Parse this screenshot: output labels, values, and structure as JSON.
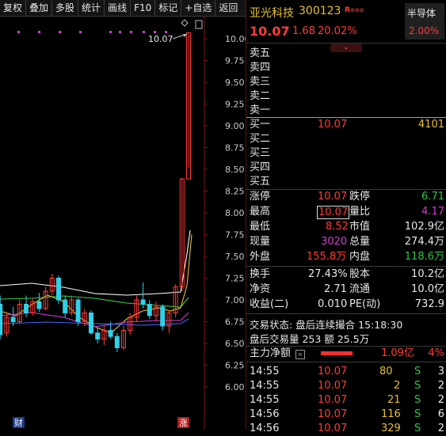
{
  "toolbar": {
    "items": [
      "复权",
      "叠加",
      "多股",
      "统计",
      "画线",
      "F10",
      "标记",
      "+自选",
      "返回"
    ]
  },
  "chart": {
    "price_ticks": [
      "10.00",
      "9.75",
      "9.50",
      "9.25",
      "9.00",
      "8.75",
      "8.50",
      "8.25",
      "8.00",
      "7.75",
      "7.50",
      "7.25",
      "7.00",
      "6.75",
      "6.50",
      "6.25",
      "6.00"
    ],
    "high_label": "10.07",
    "marker_cai": "财",
    "marker_zhang": "涨"
  },
  "chart_data": {
    "type": "candlestick",
    "ylim": [
      5.8,
      10.1
    ],
    "y_ticks": [
      6.0,
      6.25,
      6.5,
      6.75,
      7.0,
      7.25,
      7.5,
      7.75,
      8.0,
      8.25,
      8.5,
      8.75,
      9.0,
      9.25,
      9.5,
      9.75,
      10.0
    ],
    "candles": [
      {
        "o": 6.95,
        "h": 7.05,
        "l": 6.55,
        "c": 6.6
      },
      {
        "o": 6.62,
        "h": 6.85,
        "l": 6.58,
        "c": 6.8
      },
      {
        "o": 6.8,
        "h": 6.92,
        "l": 6.7,
        "c": 6.75
      },
      {
        "o": 6.75,
        "h": 7.0,
        "l": 6.72,
        "c": 6.95
      },
      {
        "o": 6.95,
        "h": 7.05,
        "l": 6.8,
        "c": 6.85
      },
      {
        "o": 6.85,
        "h": 7.02,
        "l": 6.82,
        "c": 6.98
      },
      {
        "o": 6.98,
        "h": 7.08,
        "l": 6.86,
        "c": 6.9
      },
      {
        "o": 6.9,
        "h": 7.15,
        "l": 6.88,
        "c": 7.1
      },
      {
        "o": 7.1,
        "h": 7.3,
        "l": 7.05,
        "c": 7.25
      },
      {
        "o": 7.25,
        "h": 7.28,
        "l": 6.95,
        "c": 7.0
      },
      {
        "o": 7.0,
        "h": 7.05,
        "l": 6.8,
        "c": 6.85
      },
      {
        "o": 6.85,
        "h": 7.05,
        "l": 6.82,
        "c": 7.0
      },
      {
        "o": 7.0,
        "h": 7.02,
        "l": 6.7,
        "c": 6.75
      },
      {
        "o": 6.75,
        "h": 6.9,
        "l": 6.7,
        "c": 6.85
      },
      {
        "o": 6.85,
        "h": 6.88,
        "l": 6.6,
        "c": 6.62
      },
      {
        "o": 6.62,
        "h": 6.68,
        "l": 6.5,
        "c": 6.55
      },
      {
        "o": 6.55,
        "h": 6.7,
        "l": 6.48,
        "c": 6.65
      },
      {
        "o": 6.65,
        "h": 6.75,
        "l": 6.55,
        "c": 6.58
      },
      {
        "o": 6.58,
        "h": 6.62,
        "l": 6.4,
        "c": 6.45
      },
      {
        "o": 6.45,
        "h": 6.7,
        "l": 6.42,
        "c": 6.65
      },
      {
        "o": 6.65,
        "h": 6.85,
        "l": 6.6,
        "c": 6.8
      },
      {
        "o": 6.8,
        "h": 7.05,
        "l": 6.75,
        "c": 7.0
      },
      {
        "o": 7.0,
        "h": 7.2,
        "l": 6.9,
        "c": 6.95
      },
      {
        "o": 6.95,
        "h": 7.0,
        "l": 6.78,
        "c": 6.82
      },
      {
        "o": 6.82,
        "h": 6.98,
        "l": 6.75,
        "c": 6.92
      },
      {
        "o": 6.92,
        "h": 6.95,
        "l": 6.65,
        "c": 6.7
      },
      {
        "o": 6.7,
        "h": 6.88,
        "l": 6.62,
        "c": 6.85
      },
      {
        "o": 6.85,
        "h": 7.18,
        "l": 6.8,
        "c": 7.15
      },
      {
        "o": 7.15,
        "h": 8.4,
        "l": 7.1,
        "c": 8.39
      },
      {
        "o": 8.39,
        "h": 10.07,
        "l": 8.52,
        "c": 10.07
      }
    ]
  },
  "quote": {
    "name": "亚光科技",
    "code": "300123",
    "r_badge": "R",
    "sector": "半导体",
    "price": "10.07",
    "change": "1.68",
    "change_pct": "20.02%",
    "sector_pct": "2.00%"
  },
  "order_book": {
    "sells": [
      "卖五",
      "卖四",
      "卖三",
      "卖二",
      "卖一"
    ],
    "buys": [
      {
        "label": "买一",
        "price": "10.07",
        "vol": "4101"
      },
      {
        "label": "买二",
        "price": "",
        "vol": ""
      },
      {
        "label": "买三",
        "price": "",
        "vol": ""
      },
      {
        "label": "买四",
        "price": "",
        "vol": ""
      },
      {
        "label": "买五",
        "price": "",
        "vol": ""
      }
    ]
  },
  "stats": {
    "limit_up_label": "涨停",
    "limit_up": "10.07",
    "limit_down_label": "跌停",
    "limit_down": "6.71",
    "high_label": "最高",
    "high": "10.07",
    "vol_ratio_label": "量比",
    "vol_ratio": "4.17",
    "low_label": "最低",
    "low": "8.52",
    "mktcap_label": "市值",
    "mktcap": "102.9亿",
    "cur_vol_label": "现量",
    "cur_vol": "3020",
    "total_vol_label": "总量",
    "total_vol": "274.4万",
    "outer_label": "外盘",
    "outer": "155.8万",
    "inner_label": "内盘",
    "inner": "118.6万",
    "turnover_label": "换手",
    "turnover": "27.43%",
    "equity_label": "股本",
    "equity": "10.2亿",
    "nav_label": "净资",
    "nav": "2.71",
    "float_label": "流通",
    "float": "10.0亿",
    "eps_label": "收益(二)",
    "eps": "0.010",
    "pe_label": "PE(动)",
    "pe": "732.9"
  },
  "trade_status": {
    "line1": "交易状态: 盘后连续撮合 15:18:30",
    "line2": "盘后交易量 253 额 25.5万"
  },
  "main_force": {
    "label": "主力净额",
    "amount": "1.09亿",
    "pct": "4%"
  },
  "ticks": [
    {
      "time": "14:55",
      "price": "10.07",
      "vol": "80",
      "side": "S",
      "n": "3"
    },
    {
      "time": "14:55",
      "price": "10.07",
      "vol": "2",
      "side": "S",
      "n": "2"
    },
    {
      "time": "14:55",
      "price": "10.07",
      "vol": "21",
      "side": "S",
      "n": "2"
    },
    {
      "time": "14:56",
      "price": "10.07",
      "vol": "116",
      "side": "S",
      "n": "6"
    },
    {
      "time": "14:56",
      "price": "10.07",
      "vol": "329",
      "side": "S",
      "n": "2"
    }
  ],
  "colors": {
    "up": "#ff3b3b",
    "down": "#30d0e8",
    "bg": "#000000"
  }
}
